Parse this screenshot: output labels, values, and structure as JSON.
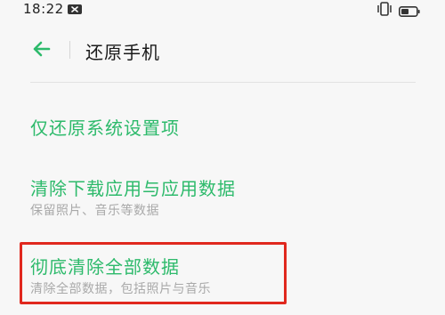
{
  "status_bar": {
    "time": "18:22",
    "icons": [
      "notification-icon",
      "vibrate-icon",
      "battery-icon"
    ]
  },
  "header": {
    "back_icon": "back-arrow-icon",
    "title": "还原手机"
  },
  "options": [
    {
      "title": "仅还原系统设置项",
      "description": ""
    },
    {
      "title": "清除下载应用与应用数据",
      "description": "保留照片、音乐等数据"
    },
    {
      "title": "彻底清除全部数据",
      "description": "清除全部数据，包括照片与音乐"
    }
  ],
  "colors": {
    "accent": "#2dba6b",
    "highlight": "#e0281e",
    "background": "#f7f7f7",
    "secondary_text": "#a9a9a9"
  }
}
